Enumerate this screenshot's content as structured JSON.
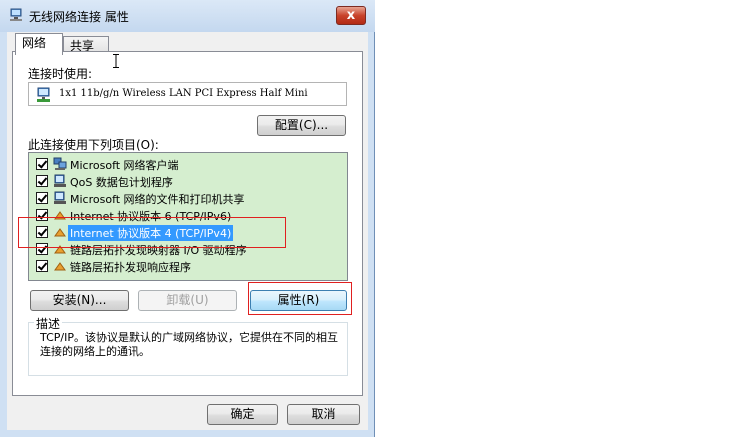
{
  "window": {
    "title": "无线网络连接 属性",
    "close_glyph": "x"
  },
  "tabs": [
    {
      "label": "网络"
    },
    {
      "label": "共享"
    }
  ],
  "connect_using_label": "连接时使用:",
  "adapter_name": "1x1 11b/g/n Wireless LAN PCI Express Half Mini",
  "configure_button": "配置(C)...",
  "items_label": "此连接使用下列项目(O):",
  "items": [
    {
      "label": "Microsoft 网络客户端",
      "checked": true,
      "icon": "network-client-icon"
    },
    {
      "label": "QoS 数据包计划程序",
      "checked": true,
      "icon": "qos-icon"
    },
    {
      "label": "Microsoft 网络的文件和打印机共享",
      "checked": true,
      "icon": "file-share-icon"
    },
    {
      "label": "Internet 协议版本 6 (TCP/IPv6)",
      "checked": true,
      "icon": "protocol-icon"
    },
    {
      "label": "Internet 协议版本 4 (TCP/IPv4)",
      "checked": true,
      "icon": "protocol-icon",
      "selected": true
    },
    {
      "label": "链路层拓扑发现映射器 I/O 驱动程序",
      "checked": true,
      "icon": "protocol-icon"
    },
    {
      "label": "链路层拓扑发现响应程序",
      "checked": true,
      "icon": "protocol-icon"
    }
  ],
  "buttons": {
    "install": "安装(N)...",
    "uninstall": "卸载(U)",
    "properties": "属性(R)",
    "ok": "确定",
    "cancel": "取消"
  },
  "description": {
    "title": "描述",
    "text": "TCP/IP。该协议是默认的广域网络协议，它提供在不同的相互连接的网络上的通讯。"
  },
  "colors": {
    "list_background": "#d5eecf",
    "selection": "#3399ff",
    "highlight_box": "#e02020"
  }
}
